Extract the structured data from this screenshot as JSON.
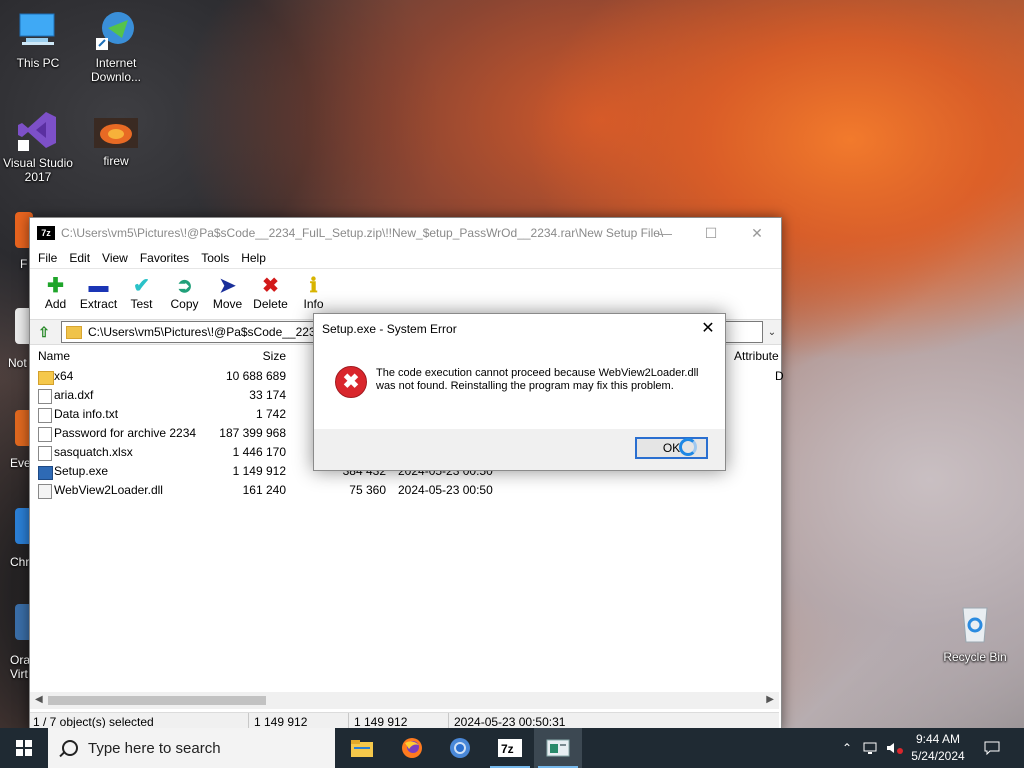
{
  "desktop": {
    "icons": [
      {
        "label": "This PC",
        "icon": "computer-icon"
      },
      {
        "label": "Internet\nDownlo...",
        "icon": "idm-icon"
      },
      {
        "label": "Visual Studio\n2017",
        "icon": "visual-studio-icon"
      },
      {
        "label": "firew",
        "icon": "image-thumbnail-icon"
      },
      {
        "label": "Recycle Bin",
        "icon": "recycle-bin-icon"
      }
    ],
    "partial_labels": [
      "F",
      "Not",
      "Eve",
      "Chr",
      "Ora\nVirt"
    ]
  },
  "window": {
    "title": "C:\\Users\\vm5\\Pictures\\!@Pa$sCode__2234_FulL_Setup.zip\\!!New_$etup_PassWrOd__2234.rar\\New Setup File\\",
    "app_icon_text": "7z",
    "menu": [
      "File",
      "Edit",
      "View",
      "Favorites",
      "Tools",
      "Help"
    ],
    "toolbar": [
      {
        "label": "Add",
        "icon": "plus-icon"
      },
      {
        "label": "Extract",
        "icon": "minus-icon"
      },
      {
        "label": "Test",
        "icon": "checkmark-icon"
      },
      {
        "label": "Copy",
        "icon": "copy-arrow-icon"
      },
      {
        "label": "Move",
        "icon": "move-arrow-icon"
      },
      {
        "label": "Delete",
        "icon": "delete-x-icon"
      },
      {
        "label": "Info",
        "icon": "info-icon"
      }
    ],
    "address": "C:\\Users\\vm5\\Pictures\\!@Pa$sCode__2234_",
    "columns": {
      "name": "Name",
      "size": "Size",
      "attributes": "Attribute"
    },
    "files": [
      {
        "name": "x64",
        "size": "10 688 689",
        "packed": "",
        "modified": "",
        "attr": "D",
        "type": "folder"
      },
      {
        "name": "aria.dxf",
        "size": "33 174",
        "packed": "",
        "modified": "",
        "attr": "",
        "type": "file"
      },
      {
        "name": "Data info.txt",
        "size": "1 742",
        "packed": "",
        "modified": "",
        "attr": "",
        "type": "file"
      },
      {
        "name": "Password for archive 2234",
        "size": "187 399 968",
        "packed": "",
        "modified": "",
        "attr": "",
        "type": "file"
      },
      {
        "name": "sasquatch.xlsx",
        "size": "1 446 170",
        "packed": "",
        "modified": "",
        "attr": "",
        "type": "file"
      },
      {
        "name": "Setup.exe",
        "size": "1 149 912",
        "packed": "384 432",
        "modified": "2024-05-23 00:50",
        "attr": "",
        "type": "exe"
      },
      {
        "name": "WebView2Loader.dll",
        "size": "161 240",
        "packed": "75 360",
        "modified": "2024-05-23 00:50",
        "attr": "",
        "type": "dll"
      }
    ],
    "status": {
      "selected": "1 / 7 object(s) selected",
      "size": "1 149 912",
      "packed": "1 149 912",
      "modified": "2024-05-23 00:50:31"
    }
  },
  "dialog": {
    "title": "Setup.exe - System Error",
    "message": "The code execution cannot proceed because WebView2Loader.dll was not found. Reinstalling the program may fix this problem.",
    "ok_label": "OK"
  },
  "taskbar": {
    "search_placeholder": "Type here to search",
    "apps": [
      "file-explorer-icon",
      "firefox-icon",
      "chrome-icon",
      "7zip-icon",
      "setup-window-icon"
    ],
    "time": "9:44 AM",
    "date": "5/24/2024"
  },
  "colors": {
    "accent": "#2a6fd0",
    "error": "#d9262c",
    "taskbar": "#1f2a33"
  }
}
